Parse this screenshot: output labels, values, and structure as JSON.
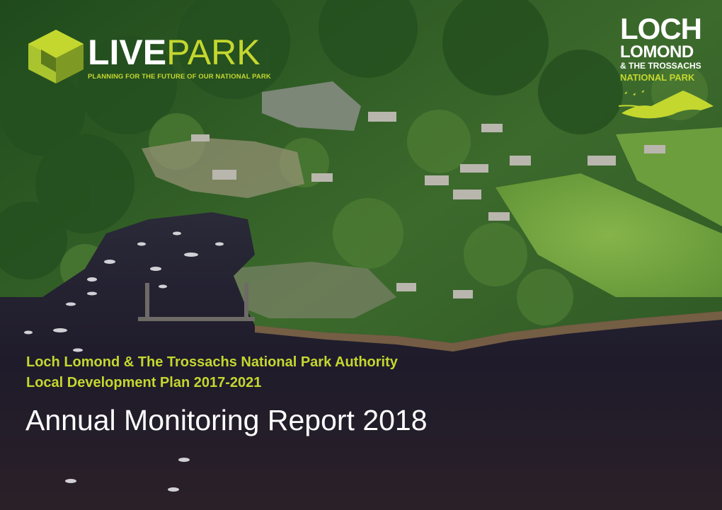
{
  "logo_live_park": {
    "word_live": "LIVE",
    "word_park": "PARK",
    "tagline": "PLANNING FOR THE FUTURE OF OUR NATIONAL PARK",
    "icon": "green-hexagon-cube-icon"
  },
  "logo_national_park": {
    "line1": "LOCH",
    "line2": "LOMOND",
    "line3": "& THE TROSSACHS",
    "line4": "NATIONAL PARK",
    "icon": "loch-and-hills-icon"
  },
  "title": {
    "authority": "Loch Lomond & The Trossachs National Park Authority",
    "plan": "Local Development Plan 2017-2021",
    "report": "Annual Monitoring Report 2018"
  },
  "colors": {
    "accent_green": "#c4d72f",
    "title_white": "#ffffff",
    "loch_water": "#1e1a2a",
    "forest": "#2f5a26"
  }
}
